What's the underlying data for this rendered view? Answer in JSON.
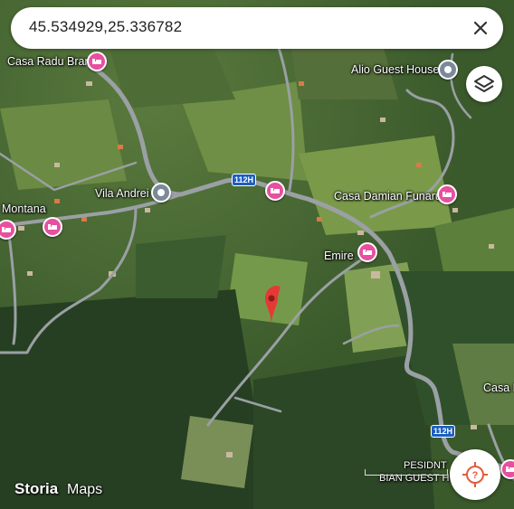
{
  "search": {
    "query": "45.534929,25.336782"
  },
  "icons": {
    "close": "close-icon",
    "layers": "layers-icon",
    "compass": "compass-icon",
    "hotel": "bed-icon",
    "place": "place-pin-icon"
  },
  "colors": {
    "hotel_pin": "#e84f9f",
    "place_pin": "#7b8a99",
    "dropped_pin": "#e53935",
    "road": "#9aa0a4",
    "route_shield": "#1d5fbf"
  },
  "places": [
    {
      "name": "Casa Radu Bran",
      "type": "hotel"
    },
    {
      "name": "Alio Guest House",
      "type": "place"
    },
    {
      "name": "Vila Andrei",
      "type": "place"
    },
    {
      "name": "Casa Damian Funaru",
      "type": "hotel"
    },
    {
      "name": "Montana",
      "type": "hotel"
    },
    {
      "name": "Emire",
      "type": "hotel"
    },
    {
      "name": "Casa P",
      "type": "hotel"
    },
    {
      "name": "PESIDNT",
      "type": "hotel"
    },
    {
      "name": "BIAN GUEST H",
      "type": "hotel"
    }
  ],
  "roads": {
    "route_label": "112H"
  },
  "attribution": {
    "watermark": "Storia",
    "brand": "Maps"
  }
}
